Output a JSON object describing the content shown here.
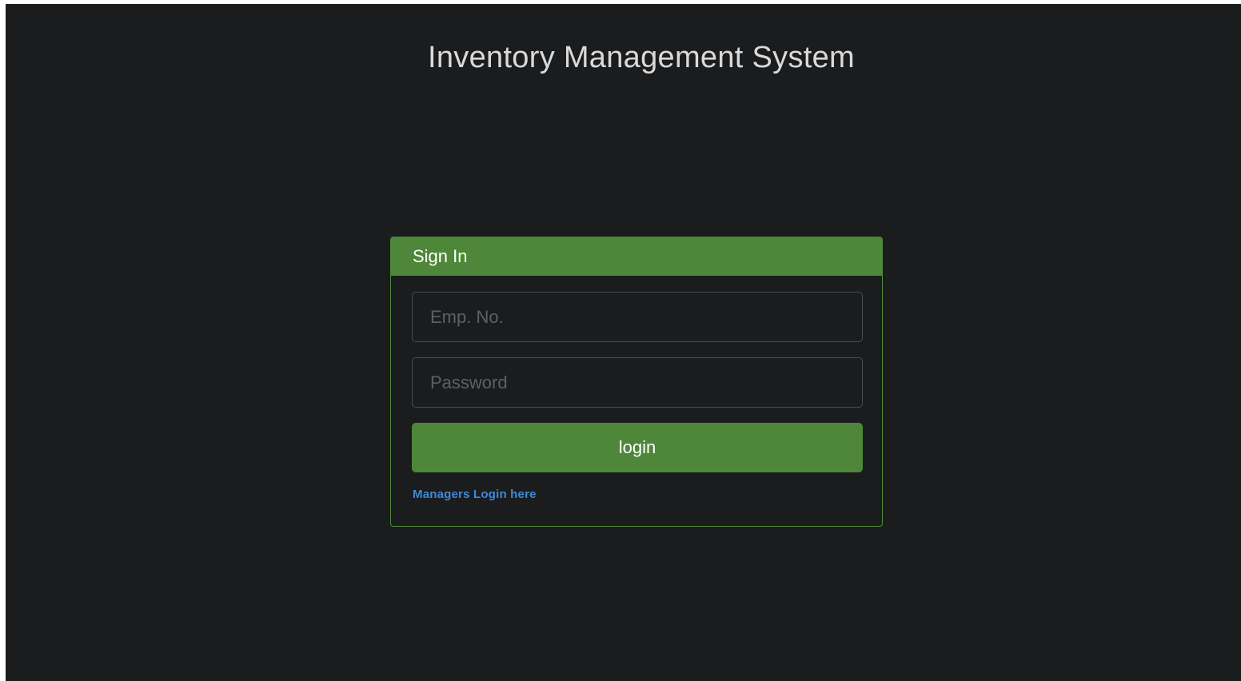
{
  "app": {
    "title": "Inventory Management System"
  },
  "signin": {
    "heading": "Sign In",
    "emp_no": {
      "placeholder": "Emp. No.",
      "value": ""
    },
    "password": {
      "placeholder": "Password",
      "value": ""
    },
    "login_label": "login",
    "managers_link": "Managers Login here"
  },
  "colors": {
    "background": "#1b1c1e",
    "accent_green": "#4e873a",
    "link_blue": "#3d8bd6",
    "title_text": "#d9d9d9"
  }
}
